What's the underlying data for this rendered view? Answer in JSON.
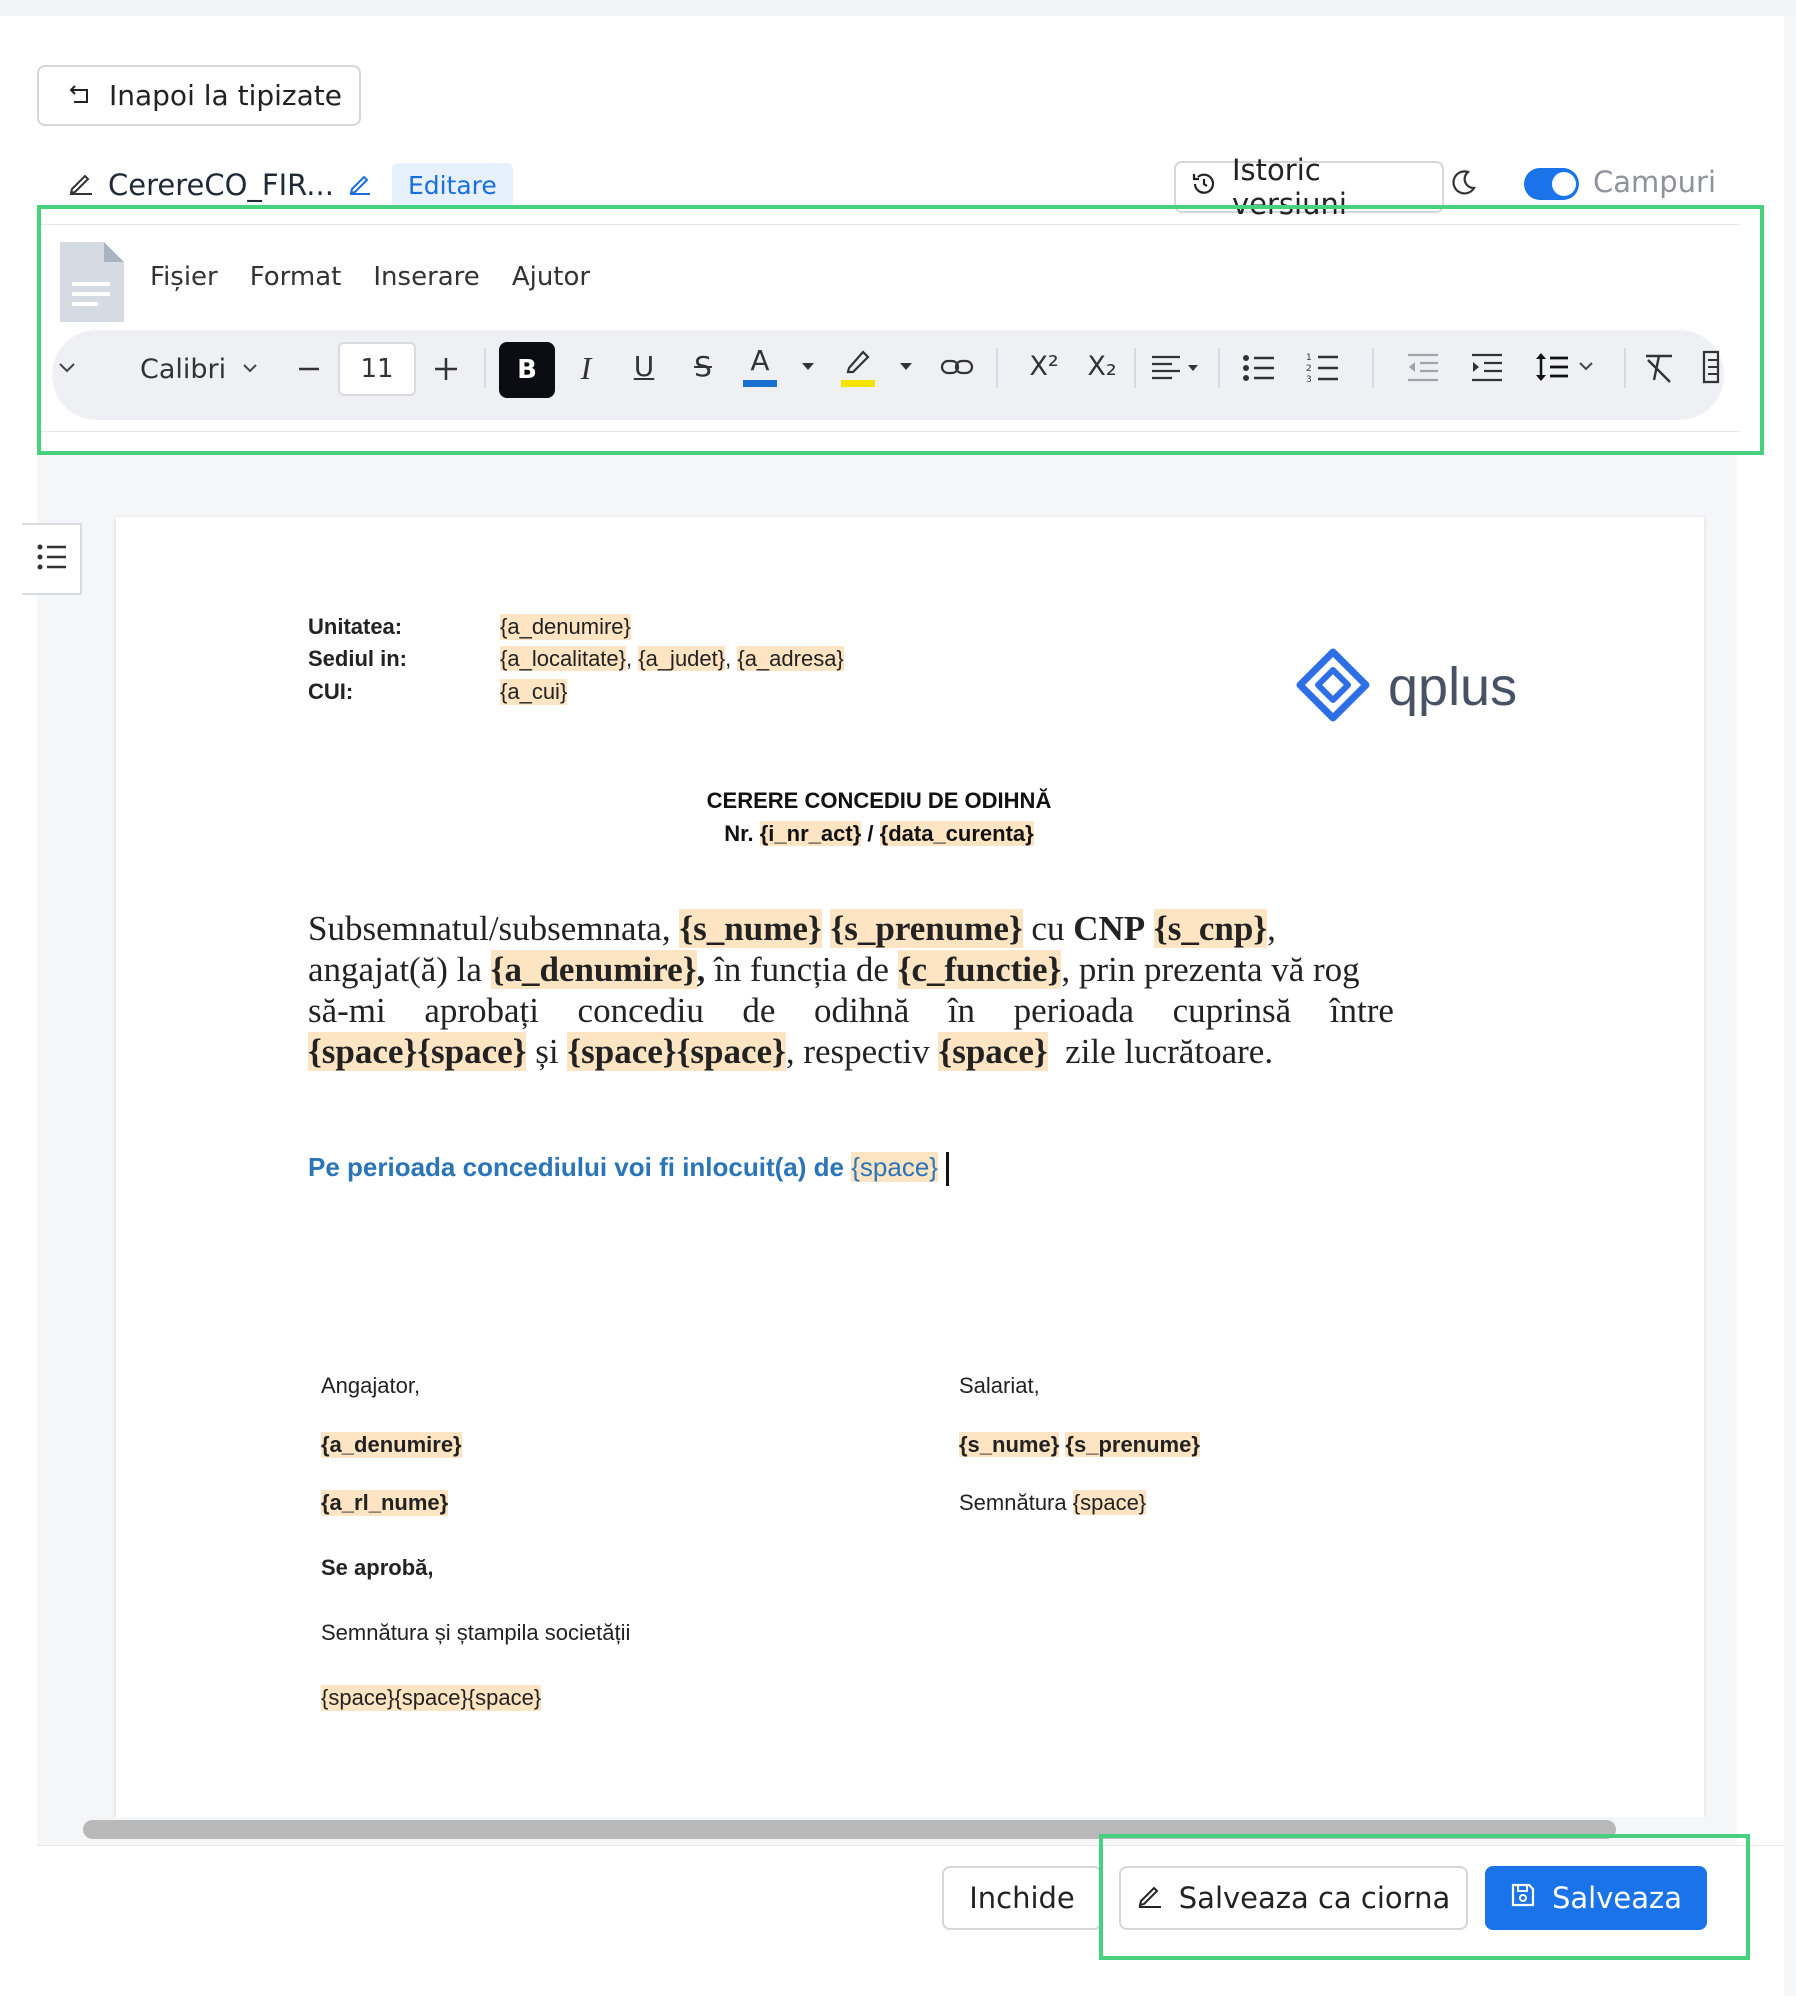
{
  "header": {
    "back_label": "Inapoi la tipizate",
    "doc_name": "CerereCO_FIR...",
    "mode_badge": "Editare",
    "history_label": "Istoric versiuni",
    "fields_toggle_label": "Campuri",
    "fields_toggle_on": true
  },
  "menu": {
    "items": [
      "Fișier",
      "Format",
      "Inserare",
      "Ajutor"
    ]
  },
  "toolbar": {
    "font_family": "Calibri",
    "font_size": "11",
    "bold_label": "B",
    "italic_label": "I",
    "underline_label": "U",
    "strike_label": "S",
    "text_color_label": "A",
    "superscript_label": "X²",
    "subscript_label": "X₂",
    "colors": {
      "text_color": "#1a6fd0",
      "highlight_color": "#f5e400"
    }
  },
  "document": {
    "header_rows": [
      {
        "label": "Unitatea:",
        "parts": [
          "{a_denumire}"
        ]
      },
      {
        "label": "Sediul in:",
        "parts": [
          "{a_localitate}",
          ", ",
          "{a_judet}",
          ", ",
          "{a_adresa}"
        ]
      },
      {
        "label": "CUI:",
        "parts": [
          "{a_cui}"
        ]
      }
    ],
    "logo_text": "qplus",
    "title": "CERERE CONCEDIU DE ODIHNĂ",
    "number_prefix": "Nr.",
    "number_field": "{i_nr_act}",
    "number_sep": "/",
    "date_field": "{data_curenta}",
    "paragraph": {
      "l1_t1": "Subsemnatul/subsemnata,",
      "l1_f1": "{s_nume}",
      "l1_f2": "{s_prenume}",
      "l1_t2": "cu",
      "l1_t3": "CNP",
      "l1_f3": "{s_cnp}",
      "l1_t4": ",",
      "l2_t1": "angajat(ă) la",
      "l2_f1": "{a_denumire}",
      "l2_t2": ",",
      "l2_t3": "în funcția de",
      "l2_f2": "{c_functie}",
      "l2_t4": ", prin prezenta vă rog",
      "l3_words": [
        "să-mi",
        "aprobați",
        "concediu",
        "de",
        "odihnă",
        "în",
        "perioada",
        "cuprinsă",
        "între"
      ],
      "l4_f1": "{space}{space}",
      "l4_t1": "și",
      "l4_f2": "{space}{space}",
      "l4_t2": ", respectiv",
      "l4_f3": "{space}",
      "l4_t3": "zile lucrătoare."
    },
    "replacement_text": "Pe perioada concediului voi fi inlocuit(a) de",
    "replacement_field": "{space}",
    "signatures": {
      "employer_label": "Angajator,",
      "employer_name": "{a_denumire}",
      "employer_rep": "{a_rl_nume}",
      "approve_label": "Se aprobă,",
      "stamp_label": "Semnătura și ștampila societății",
      "stamp_field": "{space}{space}{space}",
      "employee_label": "Salariat,",
      "employee_name_1": "{s_nume}",
      "employee_name_2": "{s_prenume}",
      "signature_label": "Semnătura",
      "signature_field": "{space}"
    }
  },
  "footer": {
    "close_label": "Inchide",
    "draft_label": "Salveaza ca ciorna",
    "save_label": "Salveaza"
  }
}
